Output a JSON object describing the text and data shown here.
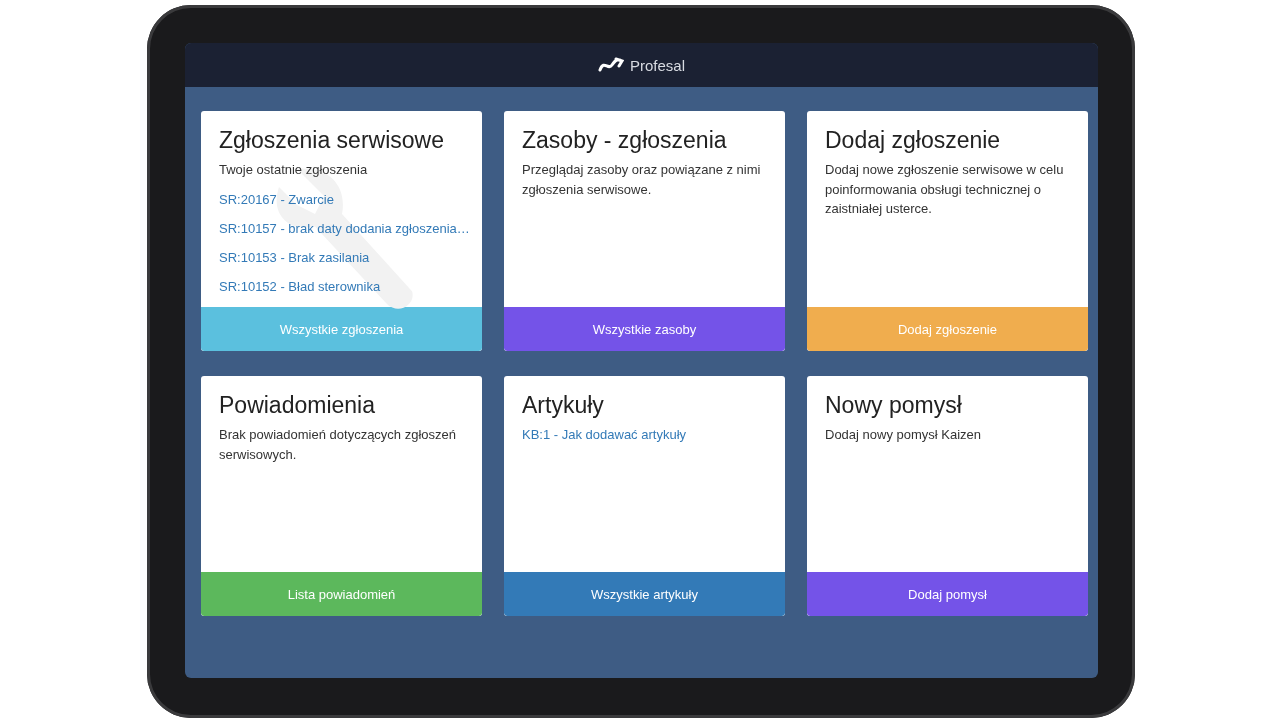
{
  "header": {
    "brand": "Profesal"
  },
  "cards": [
    {
      "title": "Zgłoszenia serwisowe",
      "background_icon": true,
      "lines": [
        {
          "kind": "text",
          "text": "Twoje ostatnie zgłoszenia"
        },
        {
          "kind": "link",
          "text": "SR:20167 - Zwarcie"
        },
        {
          "kind": "link",
          "text": "SR:10157 - brak daty dodania zgłoszenia…"
        },
        {
          "kind": "link",
          "text": "SR:10153 - Brak zasilania"
        },
        {
          "kind": "link",
          "text": "SR:10152 - Bład sterownika"
        }
      ],
      "button": {
        "label": "Wszystkie zgłoszenia",
        "color": "#5bc0de"
      }
    },
    {
      "title": "Zasoby - zgłoszenia",
      "background_icon": false,
      "lines": [
        {
          "kind": "text",
          "text": "Przeglądaj zasoby oraz powiązane z nimi zgłoszenia serwisowe."
        }
      ],
      "button": {
        "label": "Wszystkie zasoby",
        "color": "#7453e8"
      }
    },
    {
      "title": "Dodaj zgłoszenie",
      "background_icon": false,
      "lines": [
        {
          "kind": "text",
          "text": "Dodaj nowe zgłoszenie serwisowe w celu poinformowania obsługi technicznej o zaistniałej usterce."
        }
      ],
      "button": {
        "label": "Dodaj zgłoszenie",
        "color": "#f0ad4e"
      }
    },
    {
      "title": "Powiadomienia",
      "background_icon": false,
      "lines": [
        {
          "kind": "text",
          "text": "Brak powiadomień dotyczących zgłoszeń serwisowych."
        }
      ],
      "button": {
        "label": "Lista powiadomień",
        "color": "#5cb85c"
      }
    },
    {
      "title": "Artykuły",
      "background_icon": false,
      "lines": [
        {
          "kind": "link",
          "text": "KB:1 - Jak dodawać artykuły"
        }
      ],
      "button": {
        "label": "Wszystkie artykuły",
        "color": "#337ab7"
      }
    },
    {
      "title": "Nowy pomysł",
      "background_icon": false,
      "lines": [
        {
          "kind": "text",
          "text": "Dodaj nowy pomysł Kaizen"
        }
      ],
      "button": {
        "label": "Dodaj pomysł",
        "color": "#7453e8"
      }
    }
  ]
}
